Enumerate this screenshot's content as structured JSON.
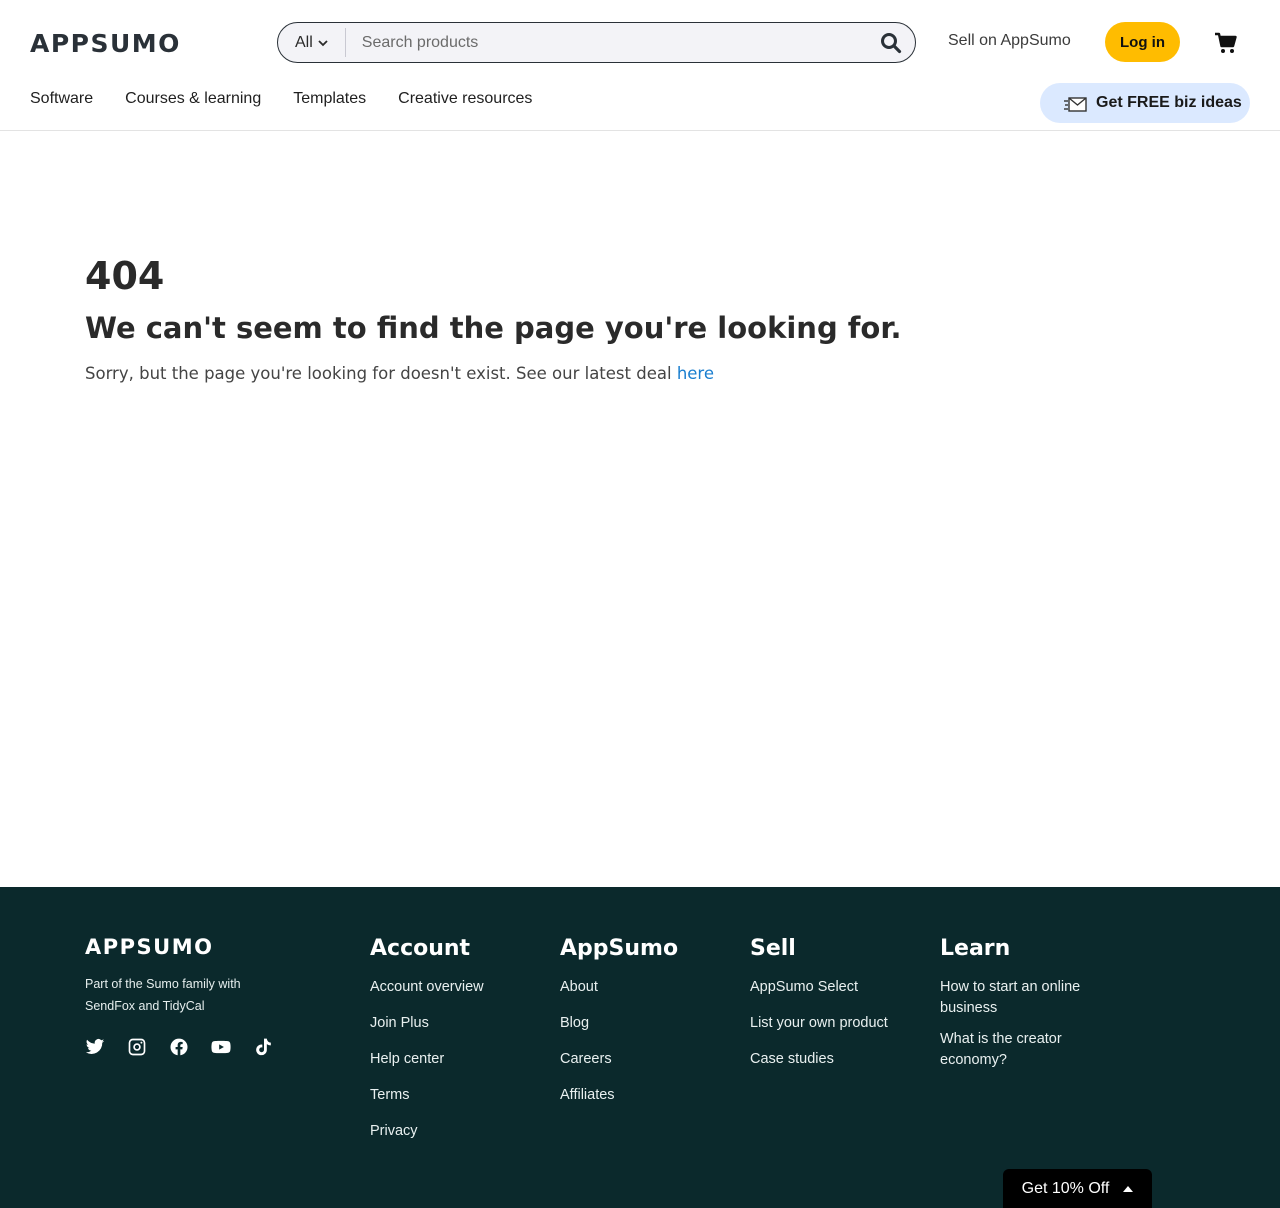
{
  "header": {
    "logo": "APPSUMO",
    "search": {
      "category": "All",
      "placeholder": "Search products"
    },
    "sell_link": "Sell on AppSumo",
    "login_label": "Log in",
    "nav": [
      "Software",
      "Courses & learning",
      "Templates",
      "Creative resources"
    ],
    "biz_ideas_label": "Get FREE biz ideas"
  },
  "main": {
    "code": "404",
    "title": "We can't seem to find the page you're looking for.",
    "text": "Sorry, but the page you're looking for doesn't exist. See our latest deal ",
    "link": "here"
  },
  "footer": {
    "logo": "APPSUMO",
    "tagline": "Part of the Sumo family with SendFox and TidyCal",
    "social": [
      "twitter-icon",
      "instagram-icon",
      "facebook-icon",
      "youtube-icon",
      "tiktok-icon"
    ],
    "columns": [
      {
        "title": "Account",
        "links": [
          "Account overview",
          "Join Plus",
          "Help center",
          "Terms",
          "Privacy"
        ]
      },
      {
        "title": "AppSumo",
        "links": [
          "About",
          "Blog",
          "Careers",
          "Affiliates"
        ]
      },
      {
        "title": "Sell",
        "links": [
          "AppSumo Select",
          "List your own product",
          "Case studies"
        ]
      },
      {
        "title": "Learn",
        "links": [
          "How to start an online business",
          "What is the creator economy?"
        ]
      }
    ]
  },
  "promo": {
    "label": "Get 10% Off"
  },
  "colors": {
    "accent": "#ffbc00",
    "footer_bg": "#0b292c",
    "link": "#1a7ecf",
    "biz_bg": "#dbe9ff"
  }
}
